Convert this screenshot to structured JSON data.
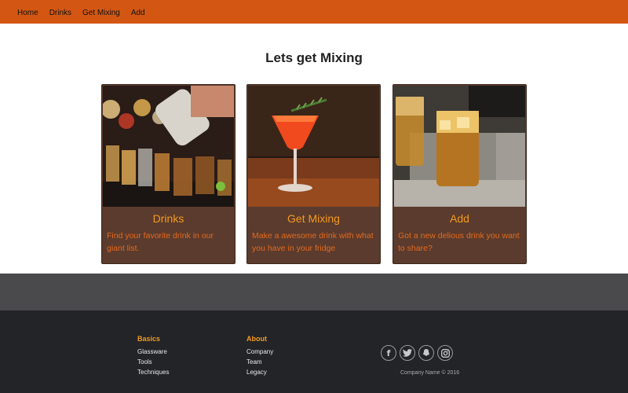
{
  "nav": {
    "items": [
      {
        "label": "Home"
      },
      {
        "label": "Drinks"
      },
      {
        "label": "Get Mixing"
      },
      {
        "label": "Add"
      }
    ],
    "background": "#d35713"
  },
  "hero": {
    "title": "Lets get Mixing"
  },
  "cards": [
    {
      "title": "Drinks",
      "text": "Find your favorite drink in our giant list.",
      "image": "shot-glasses-being-poured-photo"
    },
    {
      "title": "Get Mixing",
      "text": "Make a awesome drink with what you have in your fridge",
      "image": "orange-cocktail-with-rosemary-photo"
    },
    {
      "title": "Add",
      "text": "Got a new delious drink you want to share?",
      "image": "whiskey-glasses-on-tray-photo"
    }
  ],
  "footer": {
    "basics": {
      "heading": "Basics",
      "links": [
        "Glassware",
        "Tools",
        "Techniques"
      ]
    },
    "about": {
      "heading": "About",
      "links": [
        "Company",
        "Team",
        "Legacy"
      ]
    },
    "socials": [
      {
        "icon": "facebook-icon",
        "glyph": "f"
      },
      {
        "icon": "twitter-icon"
      },
      {
        "icon": "snapchat-icon"
      },
      {
        "icon": "instagram-icon"
      }
    ],
    "copyright": "Company Name © 2016"
  },
  "colors": {
    "accent": "#d35713",
    "card_background": "#5b3b2d",
    "card_title": "#f49a1d",
    "card_text": "#e56a1e",
    "band": "#4a4a4c",
    "footer": "#222427"
  }
}
